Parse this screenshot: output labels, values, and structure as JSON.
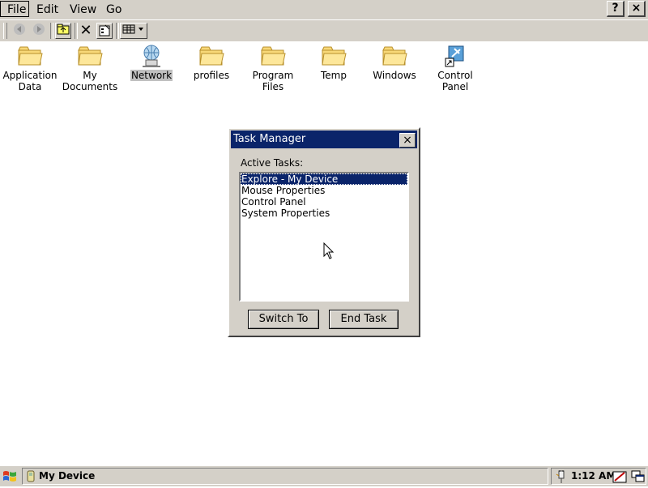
{
  "menubar": {
    "menus": [
      "File",
      "Edit",
      "View",
      "Go"
    ],
    "help_label": "?",
    "close_label": "×"
  },
  "toolbar": {
    "buttons": [
      "back-icon",
      "forward-icon",
      "up-folder-icon",
      "delete-icon",
      "properties-icon",
      "views-icon"
    ]
  },
  "desktop": {
    "items": [
      {
        "label_line1": "Application",
        "label_line2": "Data",
        "icon": "folder-icon"
      },
      {
        "label_line1": "My",
        "label_line2": "Documents",
        "icon": "folder-icon"
      },
      {
        "label_line1": "Network",
        "label_line2": "",
        "icon": "network-icon"
      },
      {
        "label_line1": "profiles",
        "label_line2": "",
        "icon": "folder-icon"
      },
      {
        "label_line1": "Program Files",
        "label_line2": "",
        "icon": "folder-icon"
      },
      {
        "label_line1": "Temp",
        "label_line2": "",
        "icon": "folder-icon"
      },
      {
        "label_line1": "Windows",
        "label_line2": "",
        "icon": "folder-icon"
      },
      {
        "label_line1": "Control",
        "label_line2": "Panel",
        "icon": "control-panel-icon"
      }
    ]
  },
  "dialog": {
    "title": "Task Manager",
    "close_label": "×",
    "list_label": "Active Tasks:",
    "tasks": [
      "Explore - My Device",
      "Mouse Properties",
      "Control Panel",
      "System Properties"
    ],
    "switch_label": "Switch To",
    "end_label": "End Task"
  },
  "taskbar": {
    "task_label": "My Device",
    "clock": "1:12 AM"
  },
  "colors": {
    "titlebar": "#0a246a",
    "chrome": "#d4d0c8",
    "desktop": "#ffffff"
  }
}
